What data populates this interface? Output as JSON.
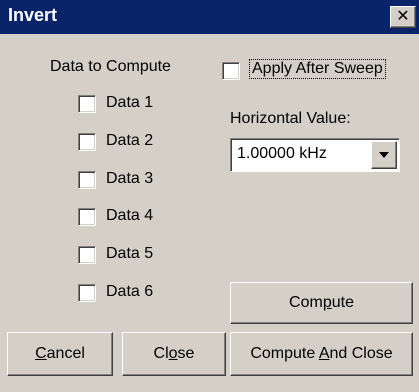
{
  "window": {
    "title": "Invert",
    "close_glyph": "✕"
  },
  "data_section": {
    "label": "Data to Compute",
    "items": [
      {
        "label": "Data 1",
        "checked": false
      },
      {
        "label": "Data 2",
        "checked": false
      },
      {
        "label": "Data 3",
        "checked": false
      },
      {
        "label": "Data 4",
        "checked": false
      },
      {
        "label": "Data 5",
        "checked": false
      },
      {
        "label": "Data 6",
        "checked": false
      }
    ]
  },
  "apply_after_sweep": {
    "label": "Apply After Sweep",
    "checked": false
  },
  "horizontal": {
    "label": "Horizontal Value:",
    "value": "1.00000 kHz"
  },
  "buttons": {
    "compute": {
      "pre": "Com",
      "mnemonic": "p",
      "post": "ute"
    },
    "cancel": {
      "pre": "",
      "mnemonic": "C",
      "post": "ancel"
    },
    "close": {
      "pre": "Cl",
      "mnemonic": "o",
      "post": "se"
    },
    "compute_and_close": {
      "pre": "Compute ",
      "mnemonic": "A",
      "post": "nd Close"
    }
  },
  "colors": {
    "titlebar": "#0a246a",
    "face": "#d4d0c8"
  }
}
